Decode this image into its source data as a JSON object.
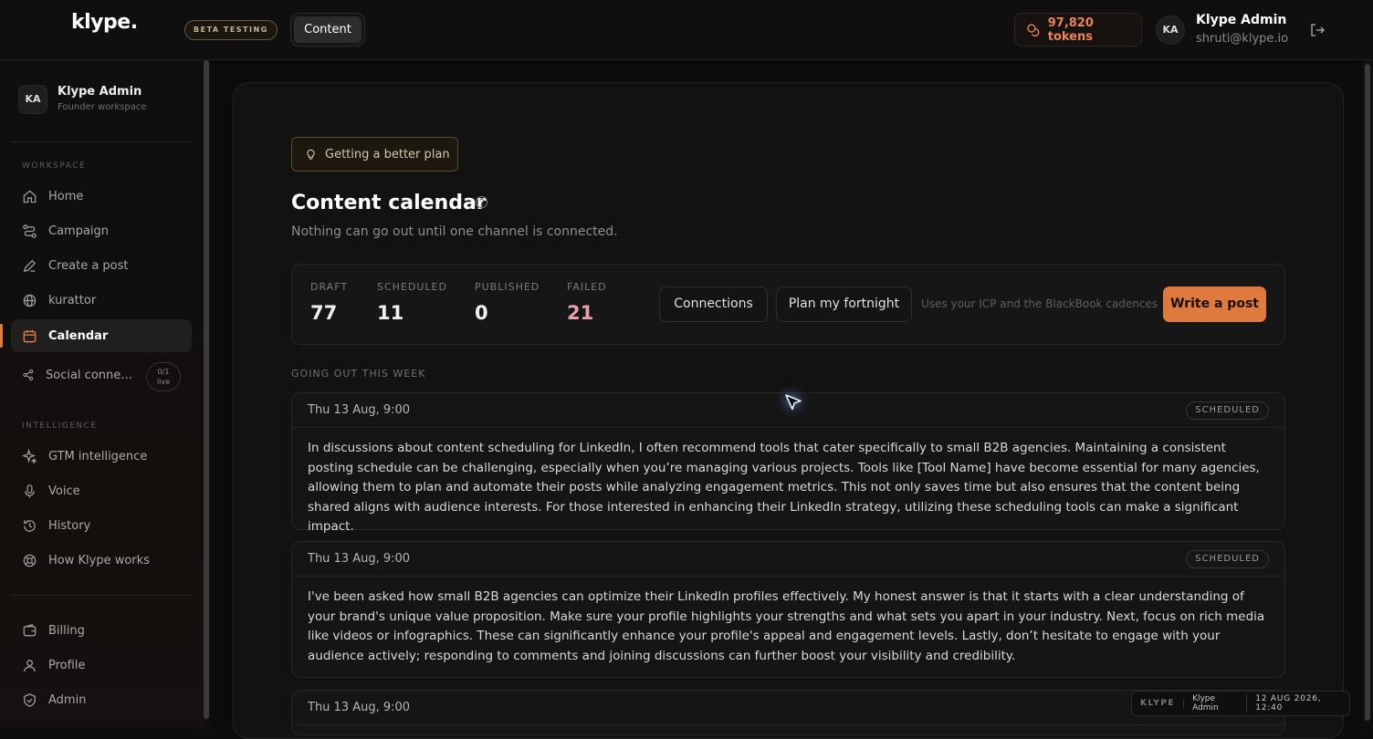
{
  "app": {
    "logo": "klype",
    "beta_label": "BETA TESTING",
    "top_tab": "Content",
    "tokens": "97,820 tokens",
    "user": {
      "initials": "KA",
      "name": "Klype Admin",
      "email": "shruti@klype.io"
    }
  },
  "sidebar": {
    "workspace": {
      "initials": "KA",
      "name": "Klype Admin",
      "subtitle": "Founder workspace"
    },
    "section_workspace": "WORKSPACE",
    "section_intelligence": "INTELLIGENCE",
    "items": [
      {
        "label": "Home",
        "icon": "home-icon"
      },
      {
        "label": "Campaign",
        "icon": "campaign-icon"
      },
      {
        "label": "Create a post",
        "icon": "pencil-icon"
      },
      {
        "label": "kurattor",
        "icon": "globe-icon"
      },
      {
        "label": "Calendar",
        "icon": "calendar-icon"
      },
      {
        "label": "Social conne…",
        "icon": "share-icon"
      },
      {
        "label": "GTM intelligence",
        "icon": "sparkle-icon"
      },
      {
        "label": "Voice",
        "icon": "microphone-icon"
      },
      {
        "label": "History",
        "icon": "history-icon"
      },
      {
        "label": "How Klype works",
        "icon": "lifebuoy-icon"
      },
      {
        "label": "Billing",
        "icon": "wallet-icon"
      },
      {
        "label": "Profile",
        "icon": "user-icon"
      },
      {
        "label": "Admin",
        "icon": "shield-icon"
      }
    ],
    "live_badge": {
      "count": "0/1",
      "text": "live"
    }
  },
  "main": {
    "plan_pill": "Getting a better plan",
    "title": "Content calendar",
    "subtitle": "Nothing can go out until one channel is connected.",
    "stats": [
      {
        "label": "DRAFT",
        "value": "77"
      },
      {
        "label": "SCHEDULED",
        "value": "11"
      },
      {
        "label": "PUBLISHED",
        "value": "0"
      },
      {
        "label": "FAILED",
        "value": "21"
      }
    ],
    "buttons": {
      "connections": "Connections",
      "plan": "Plan my fortnight",
      "write": "Write a post"
    },
    "hint": "Uses your ICP and the BlackBook cadences",
    "week_label": "GOING OUT THIS WEEK",
    "posts": [
      {
        "time": "Thu 13 Aug, 9:00",
        "status": "SCHEDULED",
        "body": "In discussions about content scheduling for LinkedIn, I often recommend tools that cater specifically to small B2B agencies. Maintaining a consistent posting schedule can be challenging, especially when you’re managing various projects. Tools like [Tool Name] have become essential for many agencies, allowing them to plan and automate their posts while analyzing engagement metrics. This not only saves time but also ensures that the content being shared aligns with audience interests. For those interested in enhancing their LinkedIn strategy, utilizing these scheduling tools can make a significant impact."
      },
      {
        "time": "Thu 13 Aug, 9:00",
        "status": "SCHEDULED",
        "body": "I've been asked how small B2B agencies can optimize their LinkedIn profiles effectively. My honest answer is that it starts with a clear understanding of your brand's unique value proposition. Make sure your profile highlights your strengths and what sets you apart in your industry. Next, focus on rich media like videos or infographics. These can significantly enhance your profile's appeal and engagement levels. Lastly, don’t hesitate to engage with your audience actively; responding to comments and joining discussions can further boost your visibility and credibility."
      },
      {
        "time": "Thu 13 Aug, 9:00"
      }
    ]
  },
  "footer": {
    "brand": "KLYPE",
    "user": "Klype Admin",
    "date": "12 AUG 2026, 12:40"
  }
}
